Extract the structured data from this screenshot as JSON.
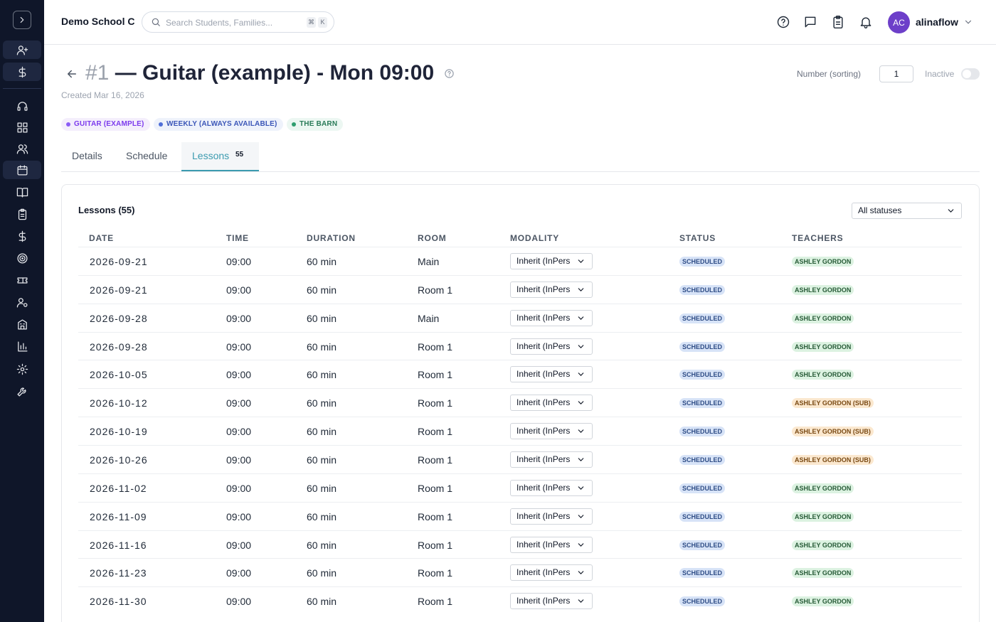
{
  "topbar": {
    "school_name": "Demo School C",
    "search_placeholder": "Search Students, Families...",
    "shortcut_keys": [
      "⌘",
      "K"
    ],
    "user_initials": "AC",
    "username": "alinaflow"
  },
  "header": {
    "number": "#1",
    "title": " — Guitar (example) - Mon 09:00",
    "created": "Created Mar 16, 2026",
    "sort_label": "Number (sorting)",
    "sort_value": "1",
    "inactive_label": "Inactive",
    "inactive_on": false
  },
  "tags": [
    "GUITAR (EXAMPLE)",
    "WEEKLY (ALWAYS AVAILABLE)",
    "THE BARN"
  ],
  "tabs": {
    "items": [
      {
        "label": "Details"
      },
      {
        "label": "Schedule"
      },
      {
        "label": "Lessons"
      }
    ],
    "active": "Lessons",
    "lessons_count": "55"
  },
  "lessons": {
    "title": "Lessons (55)",
    "filter_value": "All statuses",
    "columns": [
      "DATE",
      "TIME",
      "DURATION",
      "ROOM",
      "MODALITY",
      "STATUS",
      "TEACHERS"
    ],
    "rows": [
      {
        "date": "2026-09-21",
        "time": "09:00",
        "duration": "60 min",
        "room": "Main",
        "modality": "Inherit (InPers",
        "status": "SCHEDULED",
        "teacher": "ASHLEY GORDON",
        "sub": false
      },
      {
        "date": "2026-09-21",
        "time": "09:00",
        "duration": "60 min",
        "room": "Room 1",
        "modality": "Inherit (InPers",
        "status": "SCHEDULED",
        "teacher": "ASHLEY GORDON",
        "sub": false
      },
      {
        "date": "2026-09-28",
        "time": "09:00",
        "duration": "60 min",
        "room": "Main",
        "modality": "Inherit (InPers",
        "status": "SCHEDULED",
        "teacher": "ASHLEY GORDON",
        "sub": false
      },
      {
        "date": "2026-09-28",
        "time": "09:00",
        "duration": "60 min",
        "room": "Room 1",
        "modality": "Inherit (InPers",
        "status": "SCHEDULED",
        "teacher": "ASHLEY GORDON",
        "sub": false
      },
      {
        "date": "2026-10-05",
        "time": "09:00",
        "duration": "60 min",
        "room": "Room 1",
        "modality": "Inherit (InPers",
        "status": "SCHEDULED",
        "teacher": "ASHLEY GORDON",
        "sub": false
      },
      {
        "date": "2026-10-12",
        "time": "09:00",
        "duration": "60 min",
        "room": "Room 1",
        "modality": "Inherit (InPers",
        "status": "SCHEDULED",
        "teacher": "ASHLEY GORDON (SUB)",
        "sub": true
      },
      {
        "date": "2026-10-19",
        "time": "09:00",
        "duration": "60 min",
        "room": "Room 1",
        "modality": "Inherit (InPers",
        "status": "SCHEDULED",
        "teacher": "ASHLEY GORDON (SUB)",
        "sub": true
      },
      {
        "date": "2026-10-26",
        "time": "09:00",
        "duration": "60 min",
        "room": "Room 1",
        "modality": "Inherit (InPers",
        "status": "SCHEDULED",
        "teacher": "ASHLEY GORDON (SUB)",
        "sub": true
      },
      {
        "date": "2026-11-02",
        "time": "09:00",
        "duration": "60 min",
        "room": "Room 1",
        "modality": "Inherit (InPers",
        "status": "SCHEDULED",
        "teacher": "ASHLEY GORDON",
        "sub": false
      },
      {
        "date": "2026-11-09",
        "time": "09:00",
        "duration": "60 min",
        "room": "Room 1",
        "modality": "Inherit (InPers",
        "status": "SCHEDULED",
        "teacher": "ASHLEY GORDON",
        "sub": false
      },
      {
        "date": "2026-11-16",
        "time": "09:00",
        "duration": "60 min",
        "room": "Room 1",
        "modality": "Inherit (InPers",
        "status": "SCHEDULED",
        "teacher": "ASHLEY GORDON",
        "sub": false
      },
      {
        "date": "2026-11-23",
        "time": "09:00",
        "duration": "60 min",
        "room": "Room 1",
        "modality": "Inherit (InPers",
        "status": "SCHEDULED",
        "teacher": "ASHLEY GORDON",
        "sub": false
      },
      {
        "date": "2026-11-30",
        "time": "09:00",
        "duration": "60 min",
        "room": "Room 1",
        "modality": "Inherit (InPers",
        "status": "SCHEDULED",
        "teacher": "ASHLEY GORDON",
        "sub": false
      }
    ]
  },
  "sidebar": {
    "icons": [
      "chevron-right-icon",
      "add-user-icon",
      "dollar-icon",
      "headset-icon",
      "dashboard-icon",
      "users-icon",
      "calendar-icon",
      "book-icon",
      "clipboard-icon",
      "billing-dollar-icon",
      "target-icon",
      "ticket-icon",
      "user-settings-icon",
      "building-icon",
      "bar-chart-icon",
      "gear-icon",
      "wrench-icon"
    ],
    "active": "calendar-icon"
  },
  "colors": {
    "sidebar_bg": "#0f1629",
    "accent": "#3c9bb0",
    "avatar": "#6d3fc9"
  }
}
